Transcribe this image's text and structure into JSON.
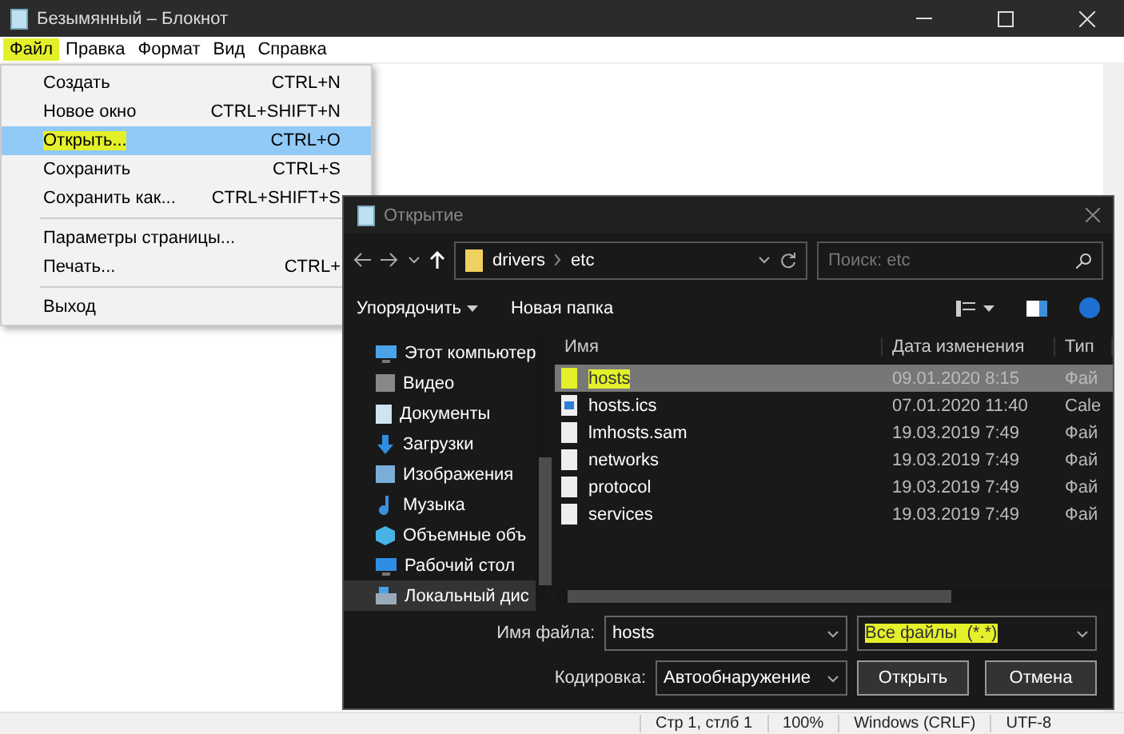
{
  "notepad": {
    "title": "Безымянный – Блокнот",
    "menu": [
      {
        "label": "Файл",
        "highlighted": true
      },
      {
        "label": "Правка",
        "highlighted": false
      },
      {
        "label": "Формат",
        "highlighted": false
      },
      {
        "label": "Вид",
        "highlighted": false
      },
      {
        "label": "Справка",
        "highlighted": false
      }
    ],
    "file_menu": [
      [
        {
          "label": "Создать",
          "shortcut": "CTRL+N",
          "selected": false,
          "highlighted": false
        },
        {
          "label": "Новое окно",
          "shortcut": "CTRL+SHIFT+N",
          "selected": false,
          "highlighted": false
        },
        {
          "label": "Открыть...",
          "shortcut": "CTRL+O",
          "selected": true,
          "highlighted": true
        },
        {
          "label": "Сохранить",
          "shortcut": "CTRL+S",
          "selected": false,
          "highlighted": false
        },
        {
          "label": "Сохранить как...",
          "shortcut": "CTRL+SHIFT+S",
          "selected": false,
          "highlighted": false
        }
      ],
      [
        {
          "label": "Параметры страницы...",
          "selected": false,
          "highlighted": false
        },
        {
          "label": "Печать...",
          "shortcut": "CTRL+",
          "selected": false,
          "highlighted": false
        }
      ],
      [
        {
          "label": "Выход",
          "selected": false,
          "highlighted": false
        }
      ]
    ],
    "status_bar": [
      "Стр 1, стлб 1",
      "100%",
      "Windows (CRLF)",
      "UTF-8"
    ]
  },
  "dialog": {
    "title": "Открытие",
    "path": [
      "drivers",
      "etc"
    ],
    "search": {
      "placeholder": "Поиск: etc"
    },
    "toolbar": [
      "Упорядочить",
      "Новая папка"
    ],
    "tree": [
      {
        "label": "Этот компьютер",
        "kind": "pc",
        "selected": false
      },
      {
        "label": "Видео",
        "kind": "video",
        "selected": false
      },
      {
        "label": "Документы",
        "kind": "docs",
        "selected": false
      },
      {
        "label": "Загрузки",
        "kind": "downloads",
        "selected": false
      },
      {
        "label": "Изображения",
        "kind": "pictures",
        "selected": false
      },
      {
        "label": "Музыка",
        "kind": "music",
        "selected": false
      },
      {
        "label": "Объемные объ",
        "kind": "objects",
        "selected": false
      },
      {
        "label": "Рабочий стол",
        "kind": "desktop",
        "selected": false
      },
      {
        "label": "Локальный дис",
        "kind": "disk",
        "selected": true
      }
    ],
    "columns": [
      "Имя",
      "Дата изменения",
      "Тип"
    ],
    "files": [
      {
        "name": "hosts",
        "date": "09.01.2020 8:15",
        "type": "Фай",
        "kind": "file",
        "selected": true,
        "highlighted": true
      },
      {
        "name": "hosts.ics",
        "date": "07.01.2020 11:40",
        "type": "Cale",
        "kind": "calendar",
        "selected": false,
        "highlighted": false
      },
      {
        "name": "lmhosts.sam",
        "date": "19.03.2019 7:49",
        "type": "Фай",
        "kind": "file",
        "selected": false,
        "highlighted": false
      },
      {
        "name": "networks",
        "date": "19.03.2019 7:49",
        "type": "Фай",
        "kind": "file",
        "selected": false,
        "highlighted": false
      },
      {
        "name": "protocol",
        "date": "19.03.2019 7:49",
        "type": "Фай",
        "kind": "file",
        "selected": false,
        "highlighted": false
      },
      {
        "name": "services",
        "date": "19.03.2019 7:49",
        "type": "Фай",
        "kind": "file",
        "selected": false,
        "highlighted": false
      }
    ],
    "file_name": {
      "label": "Имя файла:",
      "value": "hosts"
    },
    "filter": {
      "value": "Все файлы  (*.*)",
      "highlighted": true
    },
    "encoding": {
      "label": "Кодировка:",
      "value": "Автообнаружение"
    },
    "buttons": [
      "Открыть",
      "Отмена"
    ]
  }
}
